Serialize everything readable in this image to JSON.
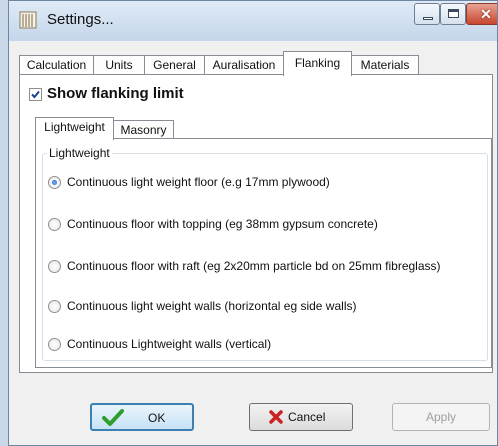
{
  "window": {
    "title": "Settings...",
    "controls": [
      "minimize-icon",
      "maximize-icon",
      "close-icon"
    ]
  },
  "tabs": [
    {
      "label": "Calculation",
      "active": false
    },
    {
      "label": "Units",
      "active": false
    },
    {
      "label": "General",
      "active": false
    },
    {
      "label": "Auralisation",
      "active": false
    },
    {
      "label": "Flanking",
      "active": true
    },
    {
      "label": "Materials",
      "active": false
    }
  ],
  "flanking": {
    "show_limit": {
      "label": "Show flanking limit",
      "checked": true
    },
    "subtabs": [
      {
        "label": "Lightweight",
        "active": true
      },
      {
        "label": "Masonry",
        "active": false
      }
    ],
    "group_label": "Lightweight",
    "options": [
      {
        "label": "Continuous light weight floor (e.g 17mm plywood)",
        "selected": true
      },
      {
        "label": "Continuous floor with topping (eg 38mm gypsum concrete)",
        "selected": false
      },
      {
        "label": "Continuous floor with raft (eg 2x20mm particle bd on 25mm fibreglass)",
        "selected": false
      },
      {
        "label": "Continuous light weight walls (horizontal eg side walls)",
        "selected": false
      },
      {
        "label": "Continuous Lightweight walls (vertical)",
        "selected": false
      }
    ]
  },
  "buttons": {
    "ok": {
      "label": "OK",
      "icon": "checkmark-icon"
    },
    "cancel": {
      "label": "Cancel",
      "icon": "x-icon"
    },
    "apply": {
      "label": "Apply",
      "disabled": true
    }
  },
  "colors": {
    "ok_icon": "#2e9e2e",
    "cancel_icon": "#cc2222",
    "check_mark": "#1f3f8a"
  }
}
